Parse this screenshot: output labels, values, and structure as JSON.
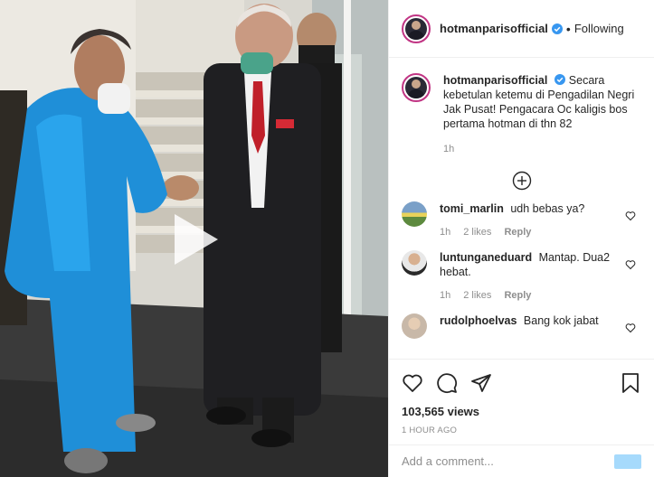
{
  "header": {
    "username": "hotmanparisofficial",
    "separator": "•",
    "follow_status": "Following"
  },
  "caption": {
    "username": "hotmanparisofficial",
    "text": "Secara kebetulan ketemu di Pengadilan Negri Jak Pusat! Pengacara Oc kaligis bos pertama hotman di thn 82",
    "time": "1h"
  },
  "comments": [
    {
      "username": "tomi_marlin",
      "text": "udh bebas ya?",
      "time": "1h",
      "likes": "2 likes",
      "reply": "Reply"
    },
    {
      "username": "luntunganeduard",
      "text": "Mantap. Dua2 hebat.",
      "time": "1h",
      "likes": "2 likes",
      "reply": "Reply"
    },
    {
      "username": "rudolphoelvas",
      "text": "Bang kok jabat",
      "time": "",
      "likes": "",
      "reply": ""
    }
  ],
  "stats": {
    "views": "103,565 views",
    "posted": "1 HOUR AGO"
  },
  "add_comment": {
    "placeholder": "Add a comment..."
  },
  "colors": {
    "accent": "#0095f6",
    "ring": "#c13584",
    "secondary_text": "#8e8e8e"
  },
  "icons": [
    "play-icon",
    "verified-icon",
    "plus-circle-icon",
    "heart-icon",
    "comment-icon",
    "share-icon",
    "bookmark-icon"
  ]
}
